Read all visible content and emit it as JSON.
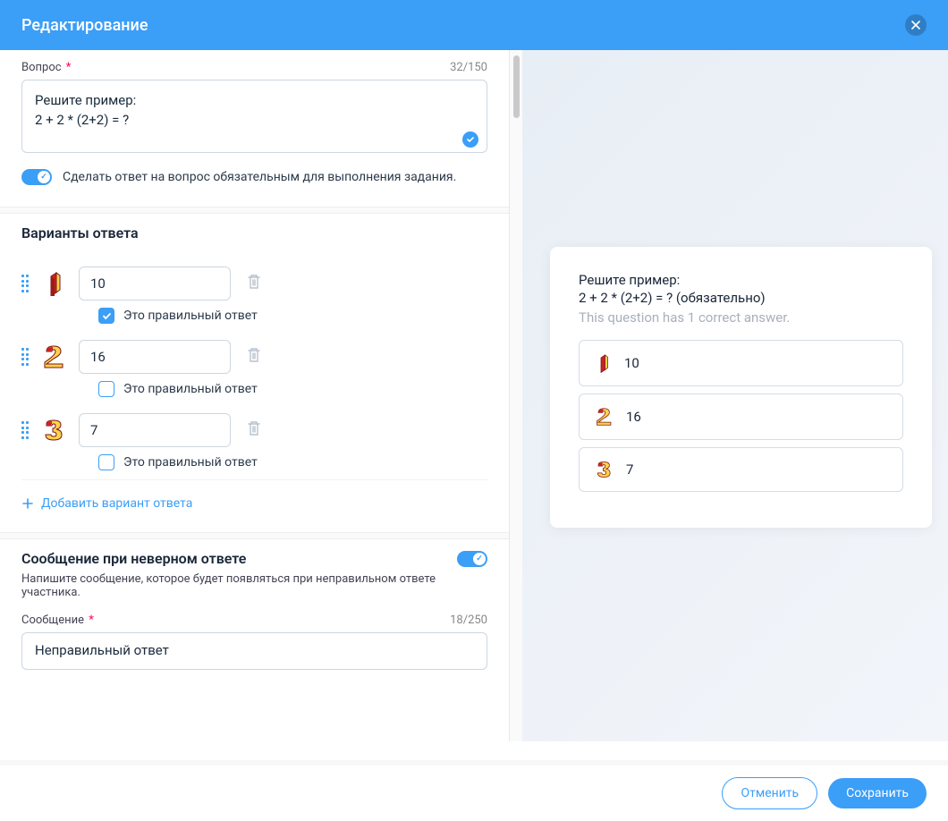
{
  "header": {
    "title": "Редактирование"
  },
  "question": {
    "label": "Вопрос",
    "counter": "32/150",
    "text": "Решите пример:\n2 + 2 * (2+2) = ?",
    "required_toggle_label": "Сделать ответ на вопрос обязательным для выполнения задания."
  },
  "answers": {
    "title": "Варианты ответа",
    "correct_label": "Это правильный ответ",
    "options": [
      {
        "value": "10",
        "correct": true
      },
      {
        "value": "16",
        "correct": false
      },
      {
        "value": "7",
        "correct": false
      }
    ],
    "add_label": "Добавить вариант ответа"
  },
  "wrong_msg": {
    "title": "Сообщение при неверном ответе",
    "help": "Напишите сообщение, которое будет появляться при неправильном ответе участника.",
    "label": "Сообщение",
    "counter": "18/250",
    "text": "Неправильный ответ"
  },
  "preview": {
    "line1": "Решите пример:",
    "line2": "2 + 2 * (2+2) = ? (обязательно)",
    "hint": "This question has 1 correct answer.",
    "options": [
      "10",
      "16",
      "7"
    ]
  },
  "footer": {
    "cancel": "Отменить",
    "save": "Сохранить"
  }
}
